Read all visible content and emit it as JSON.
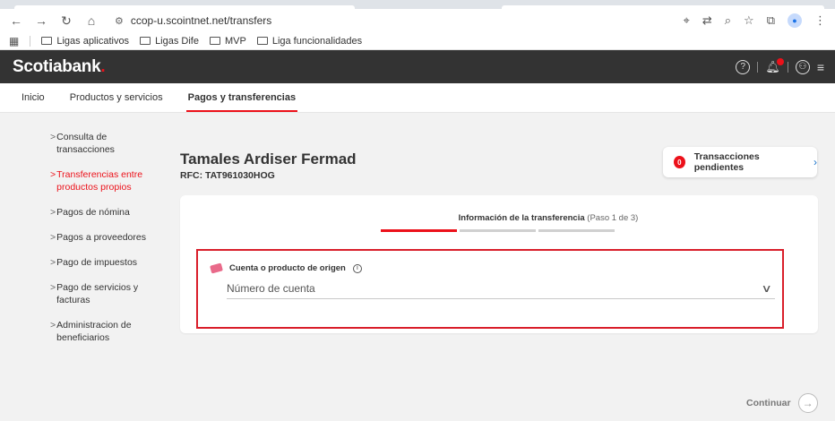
{
  "browser": {
    "url": "ccop-u.scointnet.net/transfers",
    "bookmarks": [
      "Ligas aplicativos",
      "Ligas Dife",
      "MVP",
      "Liga funcionalidades"
    ]
  },
  "header": {
    "logo_text": "Scotiabank",
    "logo_dot": "."
  },
  "nav": {
    "items": [
      "Inicio",
      "Productos y servicios",
      "Pagos y transferencias"
    ],
    "active": "Pagos y transferencias"
  },
  "sidebar": {
    "items": [
      {
        "label": "Consulta de transacciones"
      },
      {
        "label": "Transferencias entre productos propios"
      },
      {
        "label": "Pagos de nómina"
      },
      {
        "label": "Pagos a proveedores"
      },
      {
        "label": "Pago de impuestos"
      },
      {
        "label": "Pago de servicios y facturas"
      },
      {
        "label": "Administracion de beneficiarios"
      }
    ]
  },
  "client": {
    "name": "Tamales Ardiser Fermad",
    "rfc": "RFC: TAT961030HOG"
  },
  "pending": {
    "count": "0",
    "label": "Transacciones pendientes"
  },
  "form": {
    "step_title": "Información de la transferencia",
    "step_progress": "(Paso 1 de 3)",
    "origin_label": "Cuenta o producto de origen",
    "account_placeholder": "Número de cuenta"
  },
  "actions": {
    "continue_label": "Continuar"
  },
  "colors": {
    "brand_red": "#ec111a",
    "header_bg": "#333333"
  }
}
